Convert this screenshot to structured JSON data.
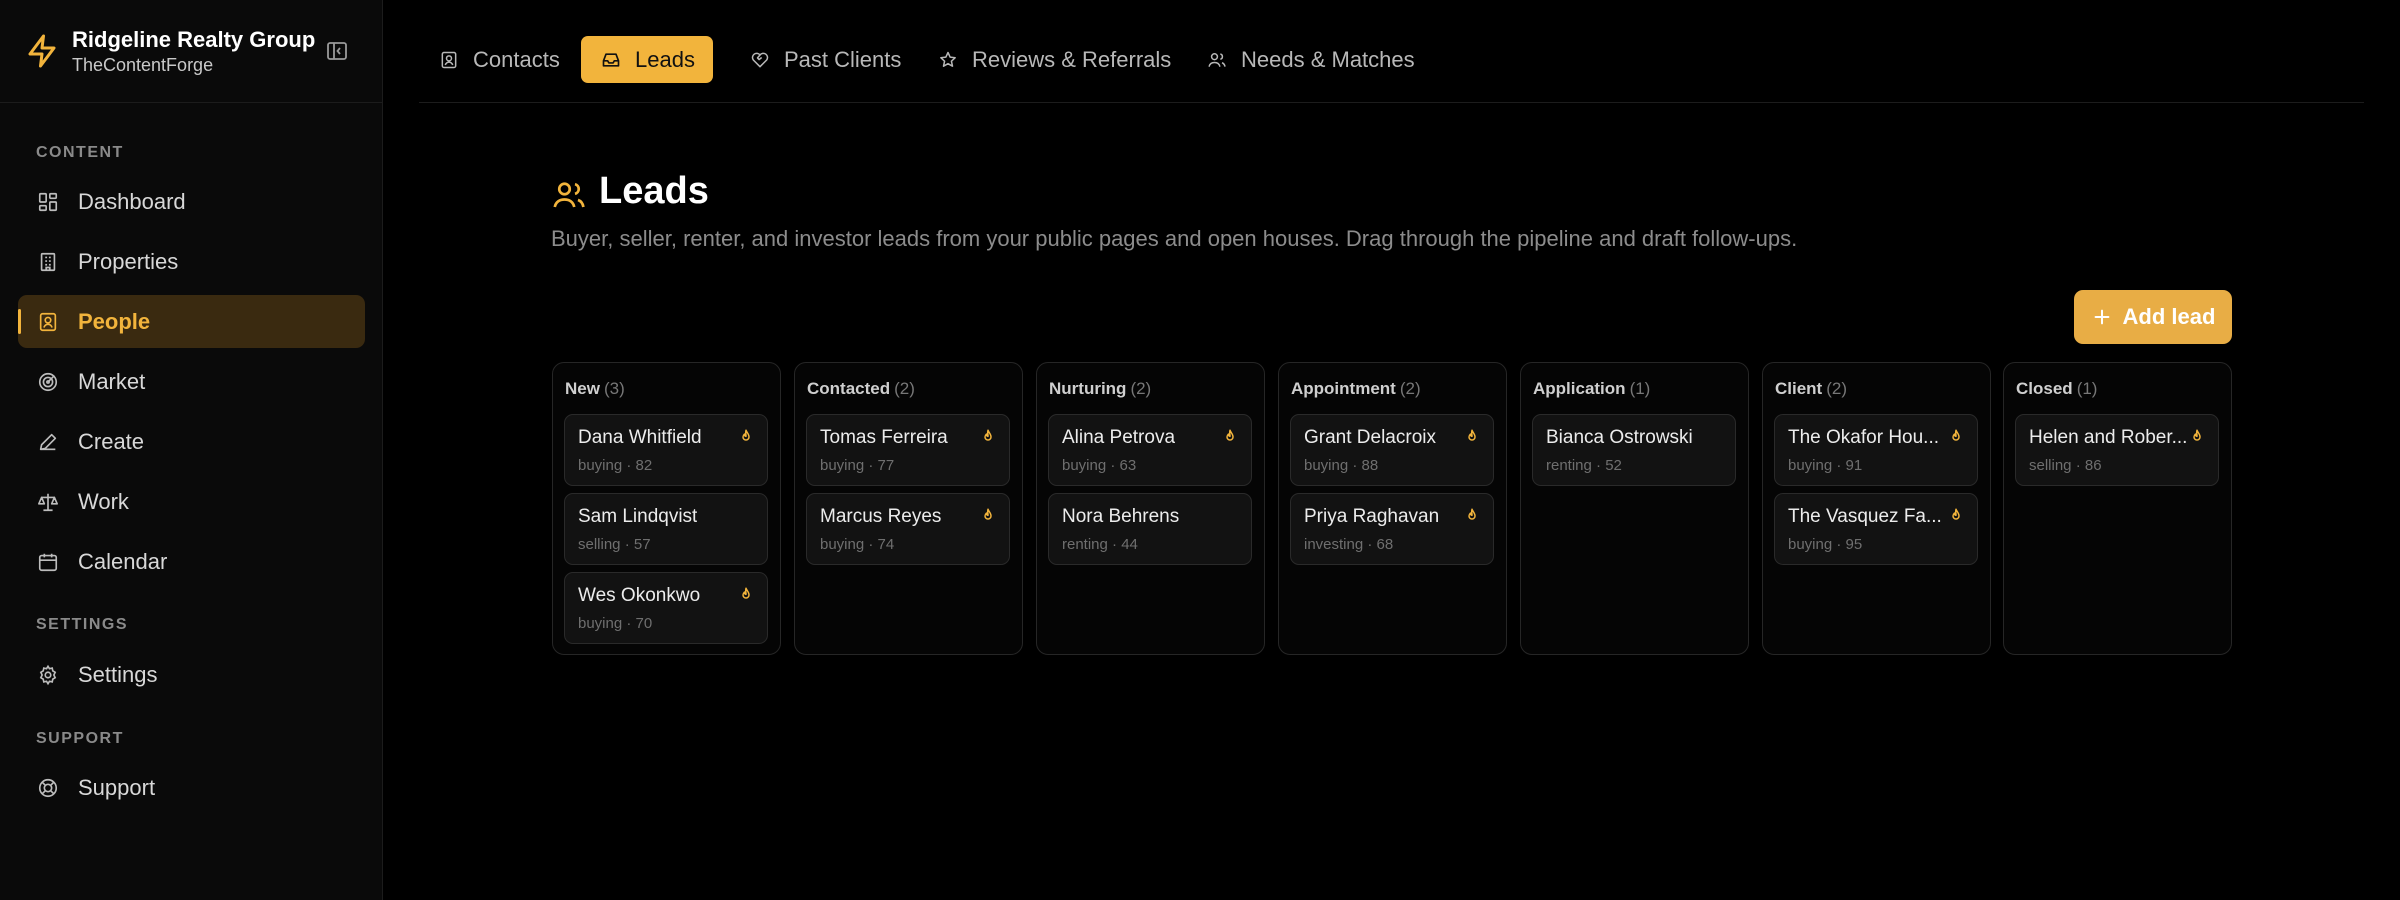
{
  "brand": {
    "name": "Ridgeline Realty Group",
    "sub": "TheContentForge"
  },
  "colors": {
    "accent": "#f2b43c",
    "background": "#000000",
    "sidebar": "#0a0a0a"
  },
  "sidebar": {
    "sections": [
      {
        "label": "CONTENT"
      },
      {
        "label": "SETTINGS"
      },
      {
        "label": "SUPPORT"
      }
    ],
    "items": [
      {
        "label": "Dashboard",
        "icon": "dashboard-icon"
      },
      {
        "label": "Properties",
        "icon": "building-icon"
      },
      {
        "label": "People",
        "icon": "contact-card-icon",
        "active": true
      },
      {
        "label": "Market",
        "icon": "radar-icon"
      },
      {
        "label": "Create",
        "icon": "pen-icon"
      },
      {
        "label": "Work",
        "icon": "scale-icon"
      },
      {
        "label": "Calendar",
        "icon": "calendar-icon"
      },
      {
        "label": "Settings",
        "icon": "gear-icon"
      },
      {
        "label": "Support",
        "icon": "lifebuoy-icon"
      }
    ]
  },
  "tabs": [
    {
      "label": "Contacts",
      "icon": "contact-icon"
    },
    {
      "label": "Leads",
      "icon": "inbox-icon",
      "active": true
    },
    {
      "label": "Past Clients",
      "icon": "heart-handshake-icon"
    },
    {
      "label": "Reviews & Referrals",
      "icon": "star-icon"
    },
    {
      "label": "Needs & Matches",
      "icon": "users-icon"
    }
  ],
  "page": {
    "title": "Leads",
    "description": "Buyer, seller, renter, and investor leads from your public pages and open houses. Drag through the pipeline and draft follow-ups.",
    "add_label": "Add lead"
  },
  "pipeline": [
    {
      "name": "New",
      "count": "(3)",
      "cards": [
        {
          "name": "Dana Whitfield",
          "meta": "buying · 82",
          "hot": true
        },
        {
          "name": "Sam Lindqvist",
          "meta": "selling · 57",
          "hot": false
        },
        {
          "name": "Wes Okonkwo",
          "meta": "buying · 70",
          "hot": true
        }
      ]
    },
    {
      "name": "Contacted",
      "count": "(2)",
      "cards": [
        {
          "name": "Tomas Ferreira",
          "meta": "buying · 77",
          "hot": true
        },
        {
          "name": "Marcus Reyes",
          "meta": "buying · 74",
          "hot": true
        }
      ]
    },
    {
      "name": "Nurturing",
      "count": "(2)",
      "cards": [
        {
          "name": "Alina Petrova",
          "meta": "buying · 63",
          "hot": true
        },
        {
          "name": "Nora Behrens",
          "meta": "renting · 44",
          "hot": false
        }
      ]
    },
    {
      "name": "Appointment",
      "count": "(2)",
      "cards": [
        {
          "name": "Grant Delacroix",
          "meta": "buying · 88",
          "hot": true
        },
        {
          "name": "Priya Raghavan",
          "meta": "investing · 68",
          "hot": true
        }
      ]
    },
    {
      "name": "Application",
      "count": "(1)",
      "cards": [
        {
          "name": "Bianca Ostrowski",
          "meta": "renting · 52",
          "hot": false
        }
      ]
    },
    {
      "name": "Client",
      "count": "(2)",
      "cards": [
        {
          "name": "The Okafor Hou...",
          "meta": "buying · 91",
          "hot": true
        },
        {
          "name": "The Vasquez Fa...",
          "meta": "buying · 95",
          "hot": true
        }
      ]
    },
    {
      "name": "Closed",
      "count": "(1)",
      "cards": [
        {
          "name": "Helen and Rober...",
          "meta": "selling · 86",
          "hot": true
        }
      ]
    }
  ]
}
